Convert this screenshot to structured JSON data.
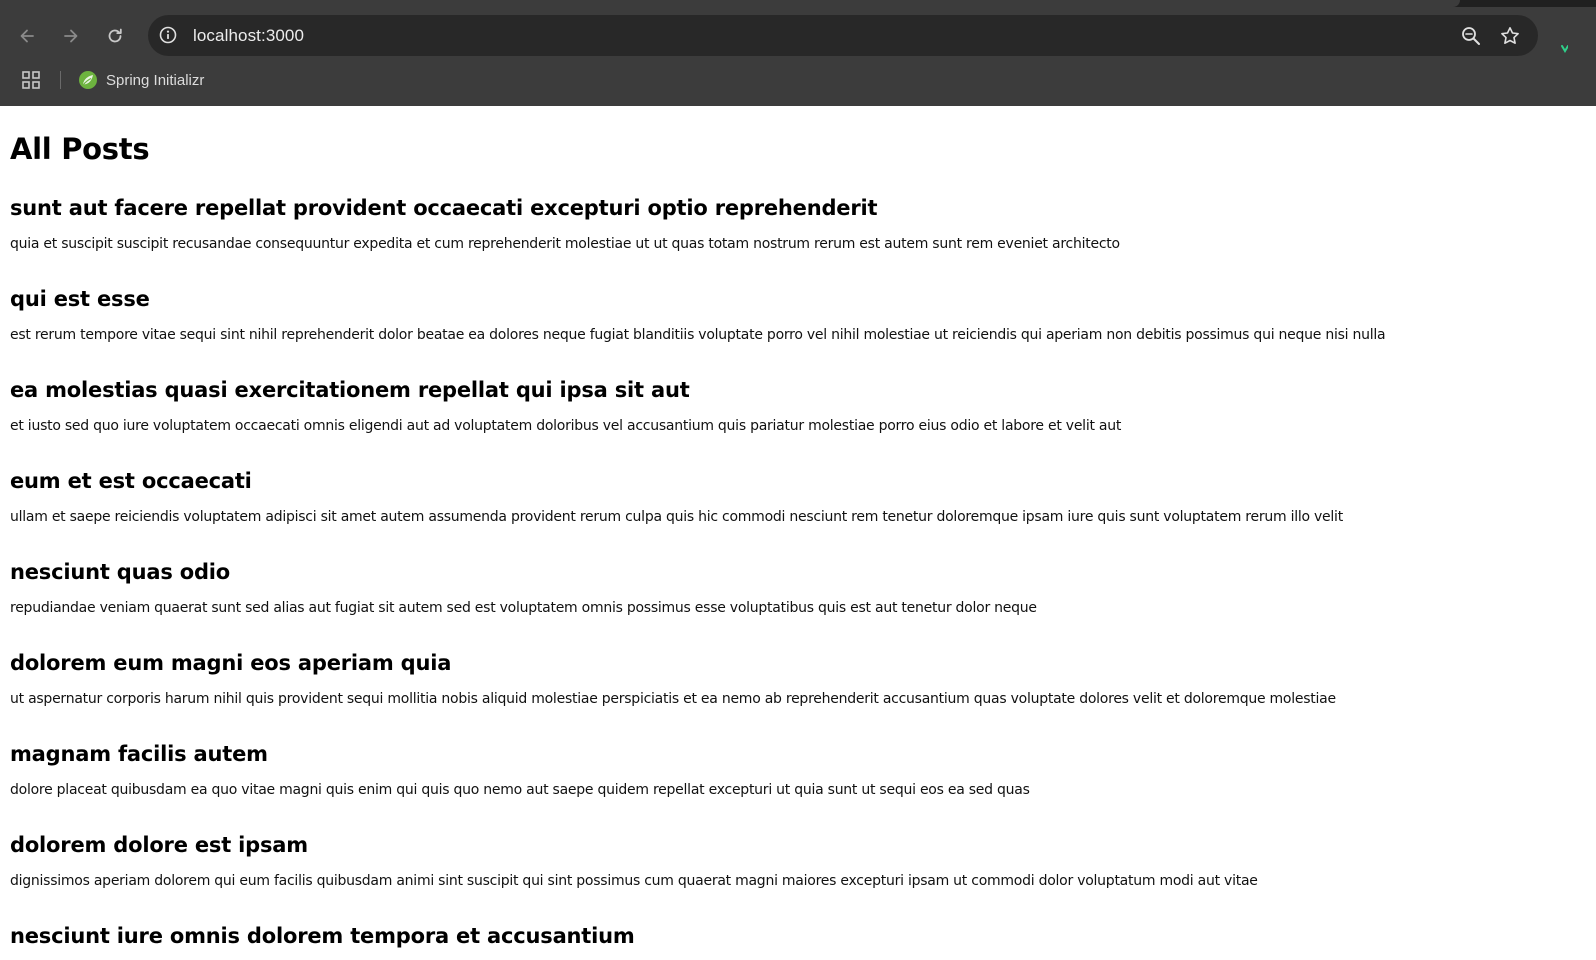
{
  "browser": {
    "url": "localhost:3000",
    "bookmarks": [
      {
        "label": "Spring Initializr",
        "icon": "spring-leaf-icon"
      }
    ],
    "accent_color": "#2fd08a"
  },
  "page": {
    "title": "All Posts",
    "posts": [
      {
        "title": "sunt aut facere repellat provident occaecati excepturi optio reprehenderit",
        "body": "quia et suscipit suscipit recusandae consequuntur expedita et cum reprehenderit molestiae ut ut quas totam nostrum rerum est autem sunt rem eveniet architecto"
      },
      {
        "title": "qui est esse",
        "body": "est rerum tempore vitae sequi sint nihil reprehenderit dolor beatae ea dolores neque fugiat blanditiis voluptate porro vel nihil molestiae ut reiciendis qui aperiam non debitis possimus qui neque nisi nulla"
      },
      {
        "title": "ea molestias quasi exercitationem repellat qui ipsa sit aut",
        "body": "et iusto sed quo iure voluptatem occaecati omnis eligendi aut ad voluptatem doloribus vel accusantium quis pariatur molestiae porro eius odio et labore et velit aut"
      },
      {
        "title": "eum et est occaecati",
        "body": "ullam et saepe reiciendis voluptatem adipisci sit amet autem assumenda provident rerum culpa quis hic commodi nesciunt rem tenetur doloremque ipsam iure quis sunt voluptatem rerum illo velit"
      },
      {
        "title": "nesciunt quas odio",
        "body": "repudiandae veniam quaerat sunt sed alias aut fugiat sit autem sed est voluptatem omnis possimus esse voluptatibus quis est aut tenetur dolor neque"
      },
      {
        "title": "dolorem eum magni eos aperiam quia",
        "body": "ut aspernatur corporis harum nihil quis provident sequi mollitia nobis aliquid molestiae perspiciatis et ea nemo ab reprehenderit accusantium quas voluptate dolores velit et doloremque molestiae"
      },
      {
        "title": "magnam facilis autem",
        "body": "dolore placeat quibusdam ea quo vitae magni quis enim qui quis quo nemo aut saepe quidem repellat excepturi ut quia sunt ut sequi eos ea sed quas"
      },
      {
        "title": "dolorem dolore est ipsam",
        "body": "dignissimos aperiam dolorem qui eum facilis quibusdam animi sint suscipit qui sint possimus cum quaerat magni maiores excepturi ipsam ut commodi dolor voluptatum modi aut vitae"
      },
      {
        "title": "nesciunt iure omnis dolorem tempora et accusantium",
        "body": ""
      }
    ]
  }
}
